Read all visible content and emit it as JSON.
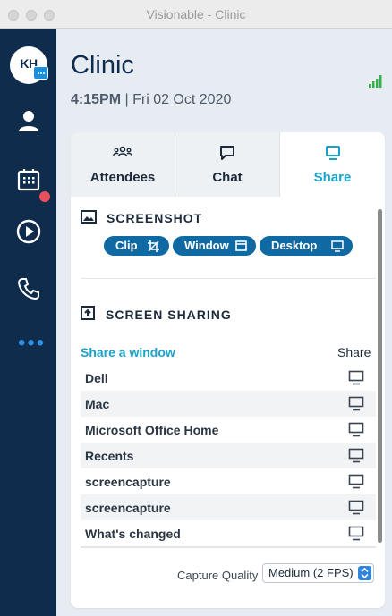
{
  "window": {
    "title": "Visionable - Clinic"
  },
  "sidebar": {
    "avatar_initials": "KH",
    "items": [
      {
        "name": "profile",
        "icon": "person-icon"
      },
      {
        "name": "calendar",
        "icon": "calendar-icon",
        "notification": true
      },
      {
        "name": "play",
        "icon": "play-icon"
      },
      {
        "name": "phone",
        "icon": "phone-icon"
      },
      {
        "name": "more",
        "icon": "more-icon",
        "label": "•••"
      }
    ]
  },
  "header": {
    "title": "Clinic",
    "time": "4:15PM",
    "date": "| Fri 02 Oct 2020"
  },
  "tabs": [
    {
      "label": "Attendees",
      "icon": "attendees-icon",
      "active": false
    },
    {
      "label": "Chat",
      "icon": "chat-icon",
      "active": false
    },
    {
      "label": "Share",
      "icon": "monitor-icon",
      "active": true
    }
  ],
  "screenshot": {
    "title": "SCREENSHOT",
    "buttons": [
      {
        "label": "Clip",
        "icon": "crop-icon"
      },
      {
        "label": "Window",
        "icon": "window-icon"
      },
      {
        "label": "Desktop",
        "icon": "monitor-icon"
      }
    ]
  },
  "screen_sharing": {
    "title": "SCREEN SHARING",
    "list_header_left": "Share a window",
    "list_header_right": "Share",
    "windows": [
      "Dell",
      "Mac",
      "Microsoft Office Home",
      "Recents",
      "screencapture",
      "screencapture",
      "What's changed"
    ]
  },
  "capture": {
    "label": "Capture Quality",
    "selected": "Medium (2 FPS)"
  },
  "colors": {
    "sidebar": "#0f2c4c",
    "accent": "#1aa3c9",
    "pill": "#0f6aa3",
    "notification": "#e8505b",
    "signal": "#2fb34a"
  }
}
